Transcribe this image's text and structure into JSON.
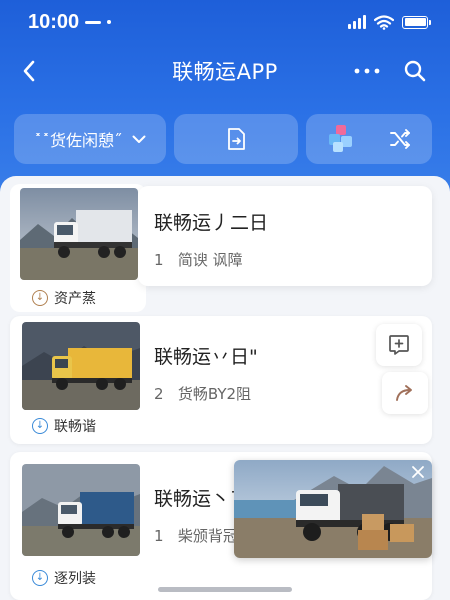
{
  "status_bar": {
    "time": "10:00"
  },
  "navbar": {
    "title": "联畅运APP"
  },
  "toolbar": {
    "filter_label": "˟˟货佐闲憩˝"
  },
  "items": [
    {
      "title": "联畅运丿二日",
      "meta_count": "1",
      "meta_text": "简谀 讽障",
      "tag": "资产蒸"
    },
    {
      "title": "联畅运丷日\"",
      "meta_count": "2",
      "meta_text": "货畅BY2阻",
      "tag": "联畅谐"
    },
    {
      "title": "联畅运丶ˉ硧",
      "meta_count": "1",
      "meta_text": "柴颁背冠6",
      "tag": "逐列装"
    }
  ],
  "icons": {
    "back": "chevron-left-icon",
    "more": "more-dots-icon",
    "search": "search-icon",
    "filter_dropdown": "chevron-down-icon",
    "doc": "document-arrow-icon",
    "apps": "cubes-icon",
    "shuffle": "shuffle-icon",
    "add": "add-square-icon",
    "share": "share-arrow-icon",
    "tag": "download-circle-icon",
    "close": "close-icon"
  },
  "colors": {
    "primary": "#2b71e6",
    "tag_brown": "#b08050",
    "tag_blue": "#3a8ad8"
  }
}
